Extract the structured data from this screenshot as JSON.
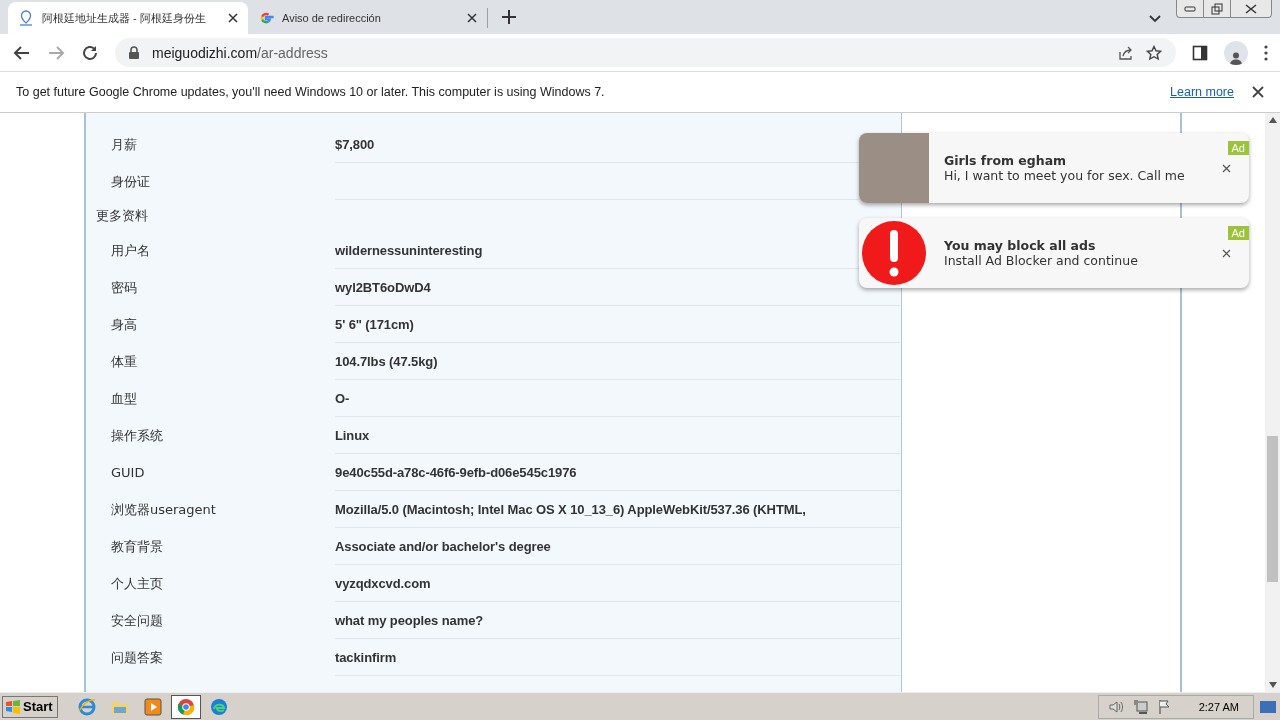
{
  "tabs": [
    {
      "kind": "pin",
      "title": "阿根廷地址生成器 - 阿根廷身份生",
      "selected": true
    },
    {
      "kind": "google",
      "title": "Aviso de redirección",
      "selected": false
    }
  ],
  "address": {
    "domain": "meiguodizhi.com",
    "path": "/ar-address"
  },
  "infobar": {
    "message": "To get future Google Chrome updates, you'll need Windows 10 or later. This computer is using Windows 7.",
    "link": "Learn more"
  },
  "rows": [
    {
      "kind": "field",
      "label": "月薪",
      "value": "$7,800"
    },
    {
      "kind": "field",
      "label": "身份证",
      "value": ""
    },
    {
      "kind": "heading",
      "label": "更多资料"
    },
    {
      "kind": "field",
      "label": "用户名",
      "value": "wildernessuninteresting"
    },
    {
      "kind": "field",
      "label": "密码",
      "value": "wyl2BT6oDwD4"
    },
    {
      "kind": "field",
      "label": "身高",
      "value": "5' 6\" (171cm)"
    },
    {
      "kind": "field",
      "label": "体重",
      "value": "104.7lbs (47.5kg)"
    },
    {
      "kind": "field",
      "label": "血型",
      "value": "O-"
    },
    {
      "kind": "field",
      "label": "操作系统",
      "value": "Linux"
    },
    {
      "kind": "field",
      "label": "GUID",
      "value": "9e40c55d-a78c-46f6-9efb-d06e545c1976"
    },
    {
      "kind": "field",
      "label": "浏览器useragent",
      "value": "Mozilla/5.0 (Macintosh; Intel Mac OS X 10_13_6) AppleWebKit/537.36 (KHTML,"
    },
    {
      "kind": "field",
      "label": "教育背景",
      "value": "Associate and/or bachelor's degree"
    },
    {
      "kind": "field",
      "label": "个人主页",
      "value": "vyzqdxcvd.com"
    },
    {
      "kind": "field",
      "label": "安全问题",
      "value": "what my peoples name?"
    },
    {
      "kind": "field",
      "label": "问题答案",
      "value": "tackinfirm"
    }
  ],
  "ads": [
    {
      "kind": "photo",
      "title": "Girls from  egham",
      "body": "Hi, I want to meet you for sex. Call me",
      "badge": "Ad"
    },
    {
      "kind": "alert",
      "title": "You may block all ads",
      "body": "Install Ad Blocker and continue",
      "badge": "Ad"
    }
  ],
  "taskbar": {
    "start": "Start",
    "apps": [
      {
        "kind": "ie",
        "selected": false
      },
      {
        "kind": "folder",
        "selected": false
      },
      {
        "kind": "media",
        "selected": false
      },
      {
        "kind": "chrome",
        "selected": true
      },
      {
        "kind": "edge",
        "selected": false
      }
    ],
    "clock": "2:27 AM"
  }
}
